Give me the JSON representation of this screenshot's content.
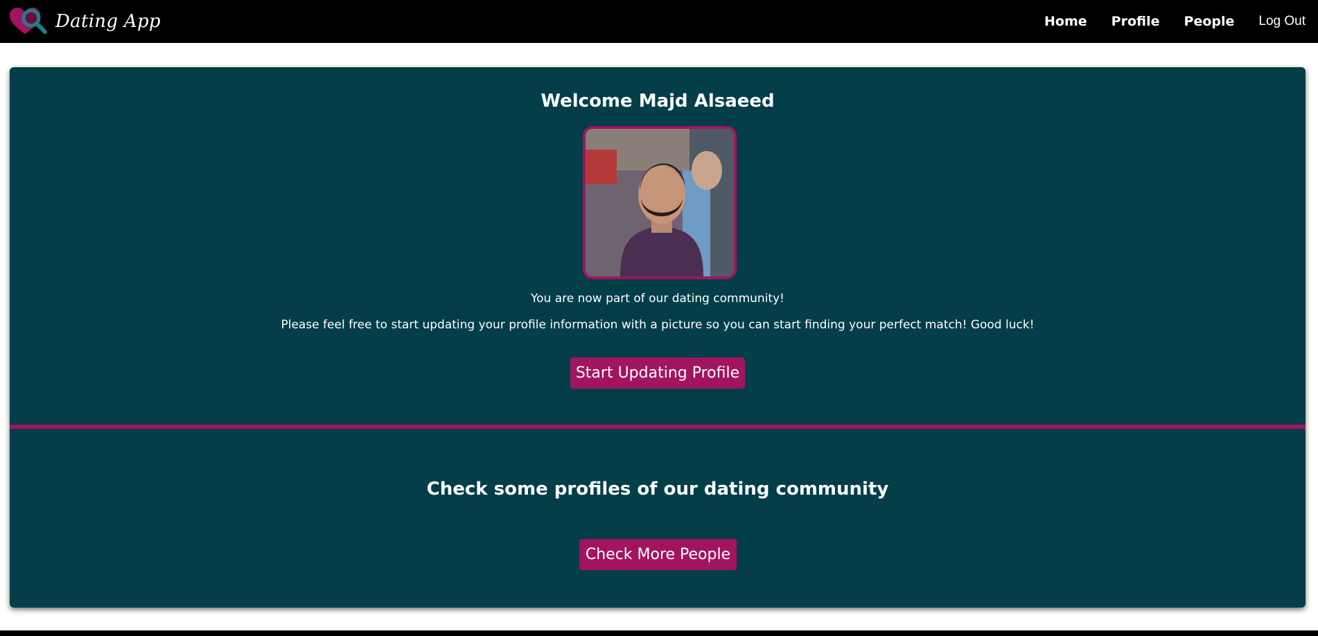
{
  "navbar": {
    "brand_name": "Dating App",
    "logo_icon": "heart-magnifier-icon",
    "links": [
      {
        "label": "Home"
      },
      {
        "label": "Profile"
      },
      {
        "label": "People"
      },
      {
        "label": "Log Out"
      }
    ]
  },
  "welcome": {
    "title": "Welcome Majd Alsaeed",
    "line1": "You are now part of our dating community!",
    "line2": "Please feel free to start updating your profile information with a picture so you can start finding your perfect match! Good luck!",
    "button_label": "Start Updating Profile"
  },
  "community": {
    "title": "Check some profiles of our dating community",
    "button_label": "Check More People"
  },
  "colors": {
    "navbar": "#000000",
    "card": "#033e49",
    "accent": "#a3145e",
    "text": "#ffffff"
  }
}
